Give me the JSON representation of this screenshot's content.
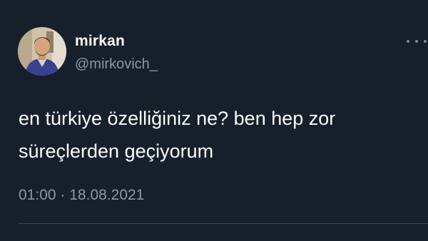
{
  "author": {
    "display_name": "mirkan",
    "handle": "@mirkovich_",
    "avatar_icon": "profile-photo"
  },
  "tweet": {
    "text_lines": [
      "en türkiye özelliğiniz ne? ben hep zor",
      "süreçlerden geçiyorum"
    ],
    "time": "01:00",
    "separator": "·",
    "date": "18.08.2021"
  },
  "more_icon": "more-options-icon",
  "colors": {
    "background": "#15202b",
    "primary_text": "#ffffff",
    "secondary_text": "#8899a6",
    "divider": "#38444d"
  }
}
